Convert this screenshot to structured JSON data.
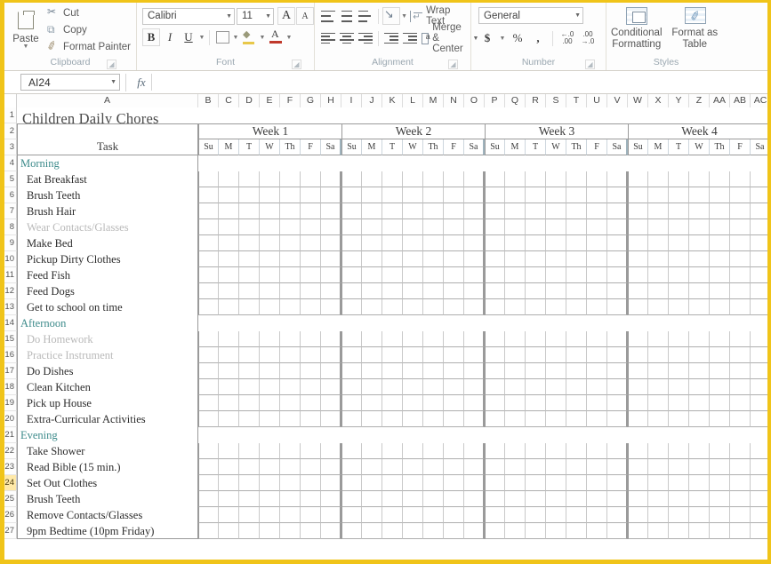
{
  "ribbon": {
    "clipboard": {
      "group_label": "Clipboard",
      "paste_label": "Paste",
      "commands": [
        {
          "label": "Cut",
          "icon": "scissors-icon"
        },
        {
          "label": "Copy",
          "icon": "copy-icon"
        },
        {
          "label": "Format Painter",
          "icon": "format-painter-icon"
        }
      ]
    },
    "font": {
      "group_label": "Font",
      "font_name": "Calibri",
      "font_size": "11",
      "grow_font": "A",
      "shrink_font": "A",
      "bold": "B",
      "italic": "I",
      "underline": "U"
    },
    "alignment": {
      "group_label": "Alignment",
      "wrap_text": "Wrap Text",
      "merge_center": "Merge & Center"
    },
    "number": {
      "group_label": "Number",
      "format": "General",
      "currency": "$",
      "percent": "%",
      "comma": ",",
      "increase_decimal": ".00",
      "decrease_decimal": ".00"
    },
    "styles": {
      "group_label": "Styles",
      "conditional_formatting": "Conditional Formatting",
      "format_as_table": "Format as Table"
    }
  },
  "formula_bar": {
    "name_box": "AI24",
    "fx_label": "fx",
    "formula_value": ""
  },
  "sheet": {
    "columns": [
      "A",
      "B",
      "C",
      "D",
      "E",
      "F",
      "G",
      "H",
      "I",
      "J",
      "K",
      "L",
      "M",
      "N",
      "O",
      "P",
      "Q",
      "R",
      "S",
      "T",
      "U",
      "V",
      "W",
      "X",
      "Y",
      "Z",
      "AA",
      "AB",
      "AC"
    ],
    "rows": [
      "1",
      "2",
      "3",
      "4",
      "5",
      "6",
      "7",
      "8",
      "9",
      "10",
      "11",
      "12",
      "13",
      "14",
      "15",
      "16",
      "17",
      "18",
      "19",
      "20",
      "21",
      "22",
      "23",
      "24",
      "25",
      "26",
      "27"
    ],
    "selected_row": "24",
    "title": "Children Daily Chores",
    "task_header": "Task",
    "weeks": [
      "Week 1",
      "Week 2",
      "Week 3",
      "Week 4"
    ],
    "days": [
      "Su",
      "M",
      "T",
      "W",
      "Th",
      "F",
      "Sa"
    ],
    "tasks": [
      {
        "row": "4",
        "label": "Morning",
        "type": "section"
      },
      {
        "row": "5",
        "label": "Eat Breakfast",
        "type": "task"
      },
      {
        "row": "6",
        "label": "Brush Teeth",
        "type": "task"
      },
      {
        "row": "7",
        "label": "Brush Hair",
        "type": "task"
      },
      {
        "row": "8",
        "label": "Wear Contacts/Glasses",
        "type": "faded"
      },
      {
        "row": "9",
        "label": "Make Bed",
        "type": "task"
      },
      {
        "row": "10",
        "label": "Pickup Dirty Clothes",
        "type": "task"
      },
      {
        "row": "11",
        "label": "Feed Fish",
        "type": "task"
      },
      {
        "row": "12",
        "label": "Feed Dogs",
        "type": "task"
      },
      {
        "row": "13",
        "label": "Get to school on time",
        "type": "task"
      },
      {
        "row": "14",
        "label": "Afternoon",
        "type": "section"
      },
      {
        "row": "15",
        "label": "Do Homework",
        "type": "faded"
      },
      {
        "row": "16",
        "label": "Practice Instrument",
        "type": "faded"
      },
      {
        "row": "17",
        "label": "Do Dishes",
        "type": "task"
      },
      {
        "row": "18",
        "label": "Clean Kitchen",
        "type": "task"
      },
      {
        "row": "19",
        "label": "Pick up House",
        "type": "task"
      },
      {
        "row": "20",
        "label": "Extra-Curricular Activities",
        "type": "task"
      },
      {
        "row": "21",
        "label": "Evening",
        "type": "section"
      },
      {
        "row": "22",
        "label": "Take Shower",
        "type": "task"
      },
      {
        "row": "23",
        "label": "Read Bible (15 min.)",
        "type": "task"
      },
      {
        "row": "24",
        "label": "Set Out Clothes",
        "type": "task"
      },
      {
        "row": "25",
        "label": "Brush Teeth",
        "type": "task"
      },
      {
        "row": "26",
        "label": "Remove Contacts/Glasses",
        "type": "task"
      },
      {
        "row": "27",
        "label": "9pm Bedtime (10pm Friday)",
        "type": "task"
      }
    ]
  },
  "colors": {
    "frame": "#f0c419",
    "section_text": "#3d8b8b",
    "selected_row": "#ffe9a8",
    "grid_line": "#c9c9c9",
    "border_strong": "#9a9a9a"
  }
}
